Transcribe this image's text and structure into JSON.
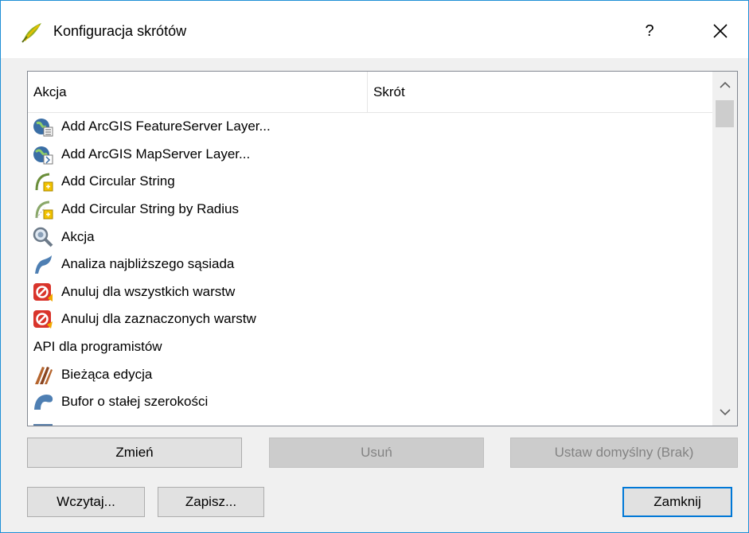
{
  "dialog": {
    "title": "Konfiguracja skrótów",
    "help_label": "?"
  },
  "list": {
    "columns": [
      "Akcja",
      "Skrót"
    ],
    "items": [
      {
        "label": "Add ArcGIS FeatureServer Layer...",
        "icon": "arcgis-featureserver-icon"
      },
      {
        "label": "Add ArcGIS MapServer Layer...",
        "icon": "arcgis-mapserver-icon"
      },
      {
        "label": "Add Circular String",
        "icon": "circular-string-icon"
      },
      {
        "label": "Add Circular String by Radius",
        "icon": "circular-string-radius-icon"
      },
      {
        "label": "Akcja",
        "icon": "action-magnifier-icon"
      },
      {
        "label": "Analiza najbliższego sąsiada",
        "icon": "nearest-neighbour-icon"
      },
      {
        "label": "Anuluj dla wszystkich warstw",
        "icon": "rollback-all-icon"
      },
      {
        "label": "Anuluj dla zaznaczonych warstw",
        "icon": "rollback-selected-icon"
      },
      {
        "label": "API dla programistów",
        "icon": ""
      },
      {
        "label": "Bieżąca edycja",
        "icon": "current-edits-icon"
      },
      {
        "label": "Bufor o stałej szerokości",
        "icon": "buffer-icon"
      }
    ]
  },
  "buttons": {
    "change": "Zmień",
    "remove": "Usuń",
    "set_default": "Ustaw domyślny (Brak)",
    "load": "Wczytaj...",
    "save": "Zapisz...",
    "close": "Zamknij"
  }
}
